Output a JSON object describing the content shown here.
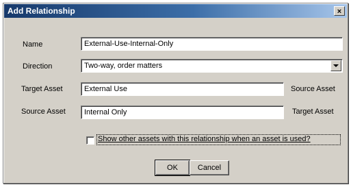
{
  "window": {
    "title": "Add Relationship",
    "close_glyph": "×"
  },
  "form": {
    "name_label": "Name",
    "name_value": "External-Use-Internal-Only",
    "direction_label": "Direction",
    "direction_value": "Two-way, order matters",
    "target_asset_label": "Target Asset",
    "target_asset_value": "External Use",
    "target_asset_side_label": "Source Asset",
    "source_asset_label": "Source Asset",
    "source_asset_value": "Internal Only",
    "source_asset_side_label": "Target Asset",
    "show_other_label": "Show other assets with this relationship when an asset is used?",
    "show_other_checked": false
  },
  "buttons": {
    "ok_label": "OK",
    "cancel_label": "Cancel"
  },
  "icons": {
    "close": "close-icon",
    "dropdown": "chevron-down-icon"
  }
}
